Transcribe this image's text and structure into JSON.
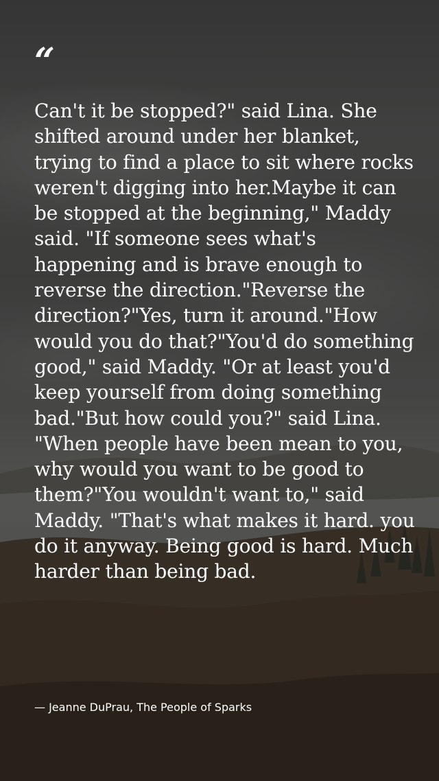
{
  "quote_mark": "“",
  "quote": {
    "text": "Can't it be stopped?\" said Lina. She shifted around under her blanket, trying to find a place to sit where rocks weren't digging into her.Maybe it can be stopped at the beginning,\" Maddy said. \"If someone sees what's happening and is brave enough to reverse the direction.\"Reverse the direction?\"Yes, turn it around.\"How would you do that?\"You'd do something good,\" said Maddy. \"Or at least you'd keep yourself from doing something bad.\"But how could you?\" said Lina. \"When people have been mean to you, why would you want to be good to them?\"You wouldn't want to,\" said Maddy. \"That's what makes it hard. you do it anyway. Being good is hard. Much harder than being bad."
  },
  "attribution": "— Jeanne DuPrau, The People of Sparks",
  "colors": {
    "text": "#ffffff",
    "background_top": "#3b3c3b",
    "background_bottom": "#2e261d"
  }
}
